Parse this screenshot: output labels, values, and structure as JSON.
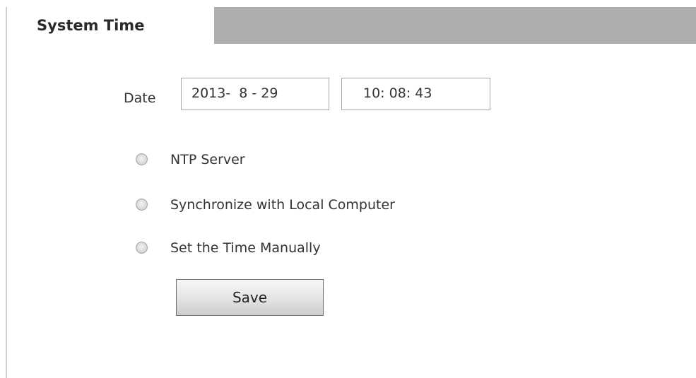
{
  "tabs": {
    "active_label": "System Time"
  },
  "date_section": {
    "label": "Date",
    "date_value": "2013-  8 - 29",
    "time_value": "10: 08: 43"
  },
  "sync_options": [
    {
      "label": "NTP Server",
      "selected": false
    },
    {
      "label": "Synchronize with Local Computer",
      "selected": false
    },
    {
      "label": "Set the Time Manually",
      "selected": false
    }
  ],
  "actions": {
    "save_label": "Save"
  },
  "colors": {
    "tab_bar": "#aeaeae",
    "text": "#333333",
    "field_border": "#a8a8a8"
  }
}
